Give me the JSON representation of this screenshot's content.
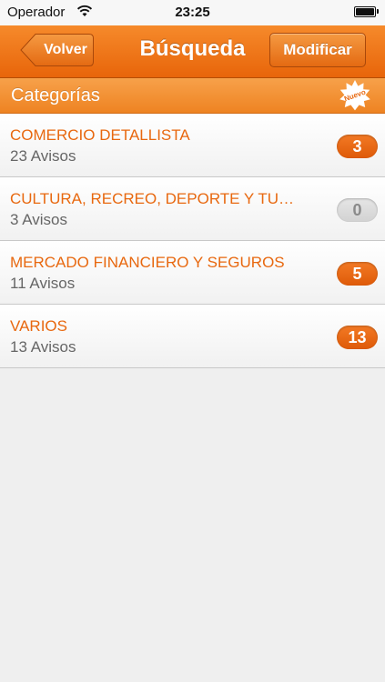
{
  "status_bar": {
    "carrier": "Operador",
    "time": "23:25"
  },
  "nav": {
    "back_label": "Volver",
    "title": "Búsqueda",
    "modify_label": "Modificar"
  },
  "section": {
    "title": "Categorías",
    "badge": "Nuevo"
  },
  "colors": {
    "accent": "#e8680f",
    "nav_bg": "#f07518"
  },
  "categories": [
    {
      "title": "COMERCIO DETALLISTA",
      "subtitle": "23 Avisos",
      "count": "3"
    },
    {
      "title": "CULTURA, RECREO, DEPORTE Y TU…",
      "subtitle": "3 Avisos",
      "count": "0"
    },
    {
      "title": "MERCADO FINANCIERO Y SEGUROS",
      "subtitle": "11 Avisos",
      "count": "5"
    },
    {
      "title": "VARIOS",
      "subtitle": "13 Avisos",
      "count": "13"
    }
  ]
}
